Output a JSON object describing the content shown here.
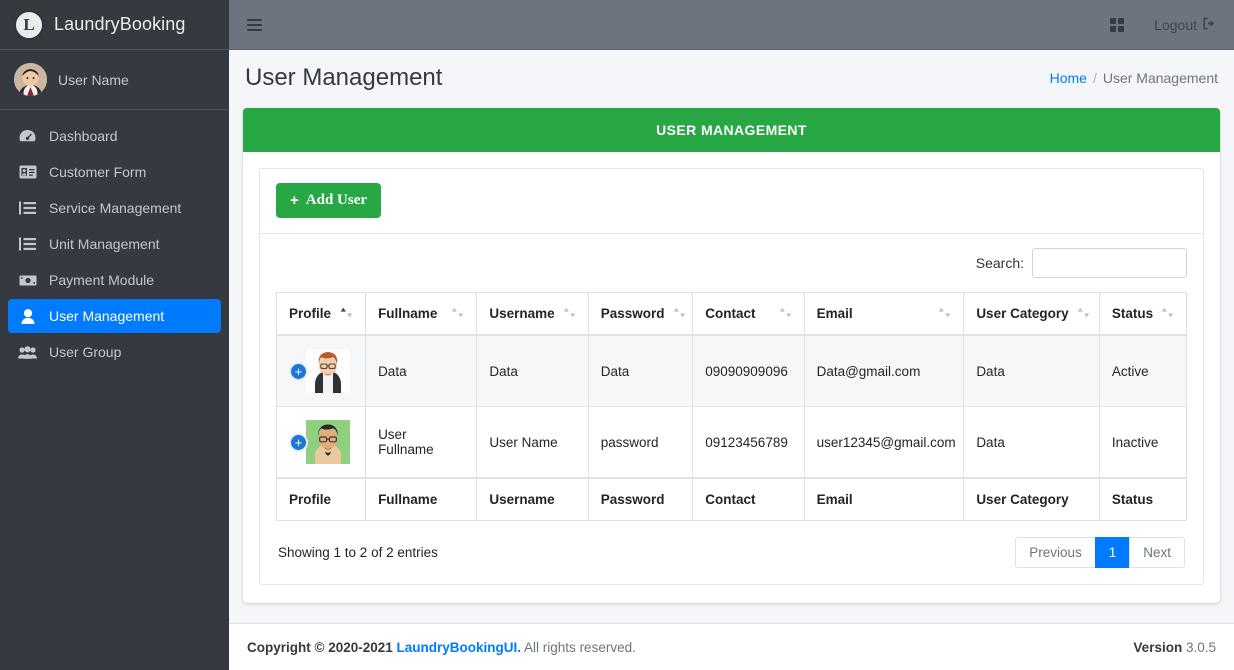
{
  "sidebar": {
    "brand": {
      "logo_letter": "L",
      "title": "LaundryBooking"
    },
    "user": {
      "name": "User Name"
    },
    "items": [
      {
        "label": "Dashboard",
        "icon": "tachometer-icon",
        "active": false
      },
      {
        "label": "Customer Form",
        "icon": "id-card-icon",
        "active": false
      },
      {
        "label": "Service Management",
        "icon": "list-icon",
        "active": false
      },
      {
        "label": "Unit Management",
        "icon": "list-icon",
        "active": false
      },
      {
        "label": "Payment Module",
        "icon": "money-bill-icon",
        "active": false
      },
      {
        "label": "User Management",
        "icon": "user-icon",
        "active": true
      },
      {
        "label": "User Group",
        "icon": "users-icon",
        "active": false
      }
    ]
  },
  "topbar": {
    "menu_icon": "hamburger-icon",
    "grid_icon": "th-large-icon",
    "logout_label": "Logout",
    "logout_icon": "sign-out-icon"
  },
  "header": {
    "title": "User Management",
    "breadcrumb": {
      "home": "Home",
      "separator": "/",
      "current": "User Management"
    }
  },
  "card": {
    "header_title": "USER MANAGEMENT",
    "add_button": {
      "label": "Add User",
      "plus": "+"
    },
    "search": {
      "label": "Search:",
      "value": "",
      "placeholder": ""
    }
  },
  "table": {
    "columns": [
      "Profile",
      "Fullname",
      "Username",
      "Password",
      "Contact",
      "Email",
      "User Category",
      "Status"
    ],
    "sorted_column_index": 0,
    "rows": [
      {
        "profile_badge": "+",
        "avatar": "avatar-woman-glasses",
        "fullname": "Data",
        "username": "Data",
        "password": "Data",
        "contact": "09090909096",
        "email": "Data@gmail.com",
        "user_category": "Data",
        "status": "Active"
      },
      {
        "profile_badge": "+",
        "avatar": "avatar-man-glasses",
        "fullname": "User Fullname",
        "username": "User Name",
        "password": "password",
        "contact": "09123456789",
        "email": "user12345@gmail.com",
        "user_category": "Data",
        "status": "Inactive"
      }
    ],
    "footer_columns": [
      "Profile",
      "Fullname",
      "Username",
      "Password",
      "Contact",
      "Email",
      "User Category",
      "Status"
    ],
    "entries_info": "Showing 1 to 2 of 2 entries",
    "pagination": {
      "previous": "Previous",
      "pages": [
        "1"
      ],
      "next": "Next",
      "active_page": "1"
    }
  },
  "footer": {
    "copyright_prefix": "Copyright © 2020-2021",
    "brand": "LaundryBookingUI.",
    "rights": "All rights reserved.",
    "version_label": "Version",
    "version_number": "3.0.5"
  },
  "colors": {
    "sidebar_bg": "#343a40",
    "topbar_bg": "#6c757d",
    "accent_green": "#28a745",
    "accent_blue": "#007bff",
    "page_bg": "#f4f6f9"
  }
}
